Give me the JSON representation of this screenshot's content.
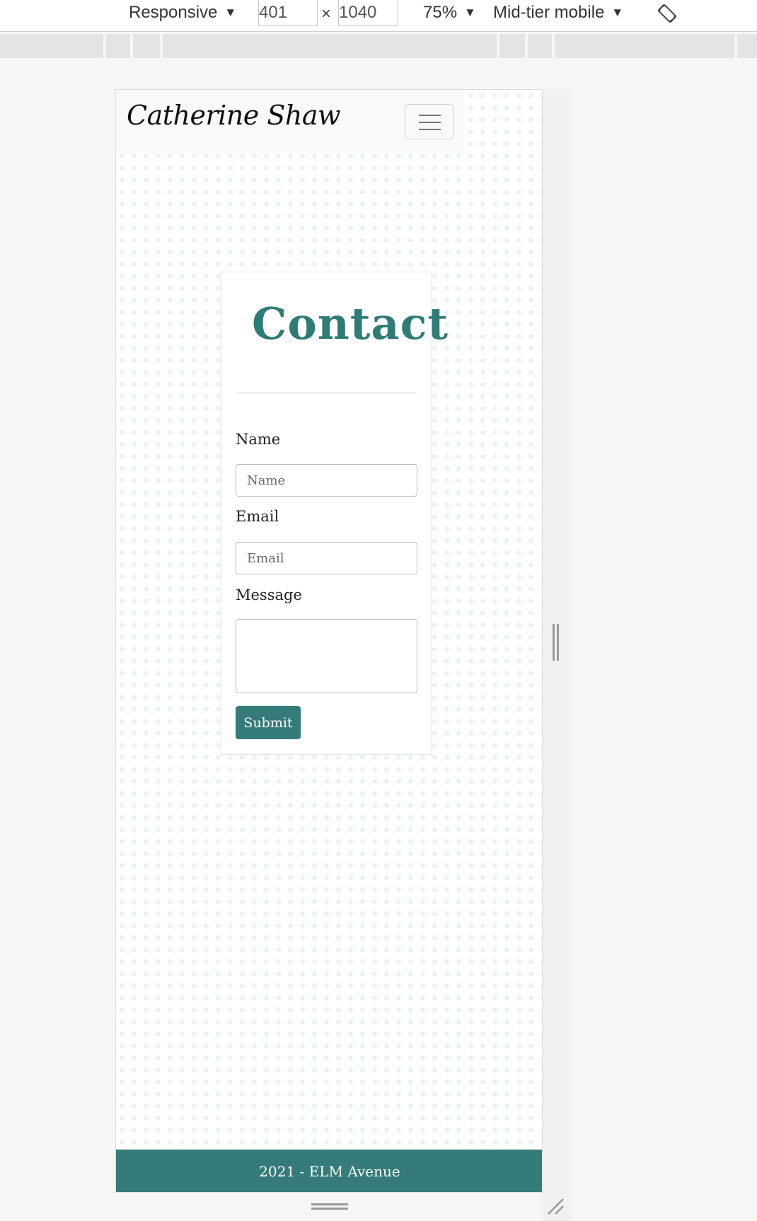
{
  "devtools": {
    "device_mode": "Responsive",
    "width_value": "401",
    "height_value": "1040",
    "times_symbol": "×",
    "zoom": "75%",
    "throttling": "Mid-tier mobile",
    "caret": "▼"
  },
  "site": {
    "brand": "Catherine Shaw",
    "contact": {
      "title": "Contact",
      "name_label": "Name",
      "name_placeholder": "Name",
      "email_label": "Email",
      "email_placeholder": "Email",
      "message_label": "Message",
      "submit_label": "Submit"
    },
    "footer": "2021 - ELM Avenue"
  },
  "colors": {
    "accent": "#357b79",
    "title": "#2f7c77",
    "navbar_bg": "#f8f9fa",
    "dot_pattern": "#e8f4f3"
  },
  "icons": {
    "rotate": "rotate-device-icon",
    "menu": "hamburger-menu-icon"
  }
}
